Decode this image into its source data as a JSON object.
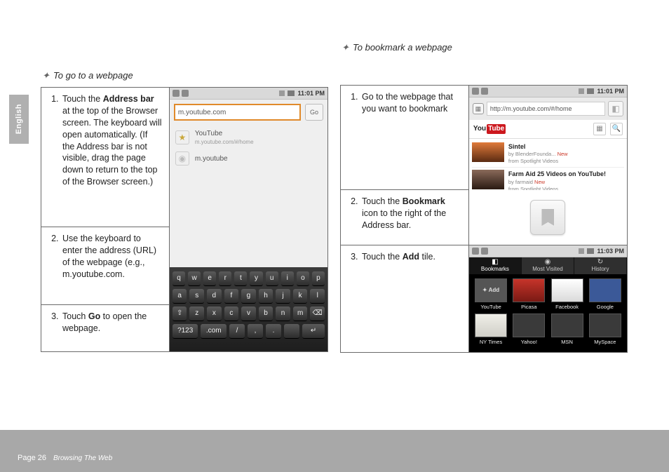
{
  "language_tab": "English",
  "left": {
    "section_title": "To go to a webpage",
    "steps": [
      {
        "n": "1",
        "html": "Touch the <b>Address bar</b> at the top of the Browser screen. The  keyboard will open automatically. (If the Address bar is not visible, drag the page down to return to the top of the Browser screen.)"
      },
      {
        "n": "2",
        "html": "Use the keyboard to enter the address (URL) of the webpage (e.g., m.youtube.com."
      },
      {
        "n": "3",
        "html": "Touch <b>Go</b> to open the webpage."
      }
    ]
  },
  "right": {
    "section_title": "To bookmark a webpage",
    "steps": [
      {
        "n": "1",
        "html": "Go to the webpage that you want to bookmark"
      },
      {
        "n": "2",
        "html": "Touch the <b>Bookmark</b> icon to the right of the Address bar."
      },
      {
        "n": "3",
        "html": "Touch the <b>Add</b> tile."
      }
    ]
  },
  "shot1": {
    "clock": "11:01 PM",
    "address_value": "m.youtube.com",
    "go": "Go",
    "sugg": [
      {
        "title": "YouTube",
        "sub": "m.youtube.com/#/home"
      },
      {
        "title": "m.youtube",
        "sub": ""
      }
    ],
    "rows": [
      [
        "q",
        "w",
        "e",
        "r",
        "t",
        "y",
        "u",
        "i",
        "o",
        "p"
      ],
      [
        "a",
        "s",
        "d",
        "f",
        "g",
        "h",
        "j",
        "k",
        "l"
      ],
      [
        "⇧",
        "z",
        "x",
        "c",
        "v",
        "b",
        "n",
        "m",
        "⌫"
      ],
      [
        "?123",
        ".com",
        "/",
        ",",
        ".",
        " ",
        "↵"
      ]
    ]
  },
  "shot2": {
    "clock": "11:01 PM",
    "url": "http://m.youtube.com/#/home",
    "logo_a": "You",
    "logo_b": "Tube",
    "feed": [
      {
        "title": "Sintel",
        "sub_a": "by BlenderFounda...",
        "sub_b": "from Spotlight Videos",
        "new": "New"
      },
      {
        "title": "Farm Aid 25 Videos on YouTube!",
        "sub_a": "by farmaid",
        "sub_b": "from Spotlight Videos",
        "new": "New"
      }
    ]
  },
  "shot4": {
    "clock": "11:03 PM",
    "tabs": [
      "Bookmarks",
      "Most Visited",
      "History"
    ],
    "add": "✦ Add",
    "tiles_top": [
      "YouTube",
      "Picasa",
      "Facebook",
      "Google"
    ],
    "tiles_bottom": [
      "NY Times",
      "Yahoo!",
      "MSN",
      "MySpace"
    ]
  },
  "footer": {
    "page": "Page 26",
    "section": "Browsing The Web"
  }
}
